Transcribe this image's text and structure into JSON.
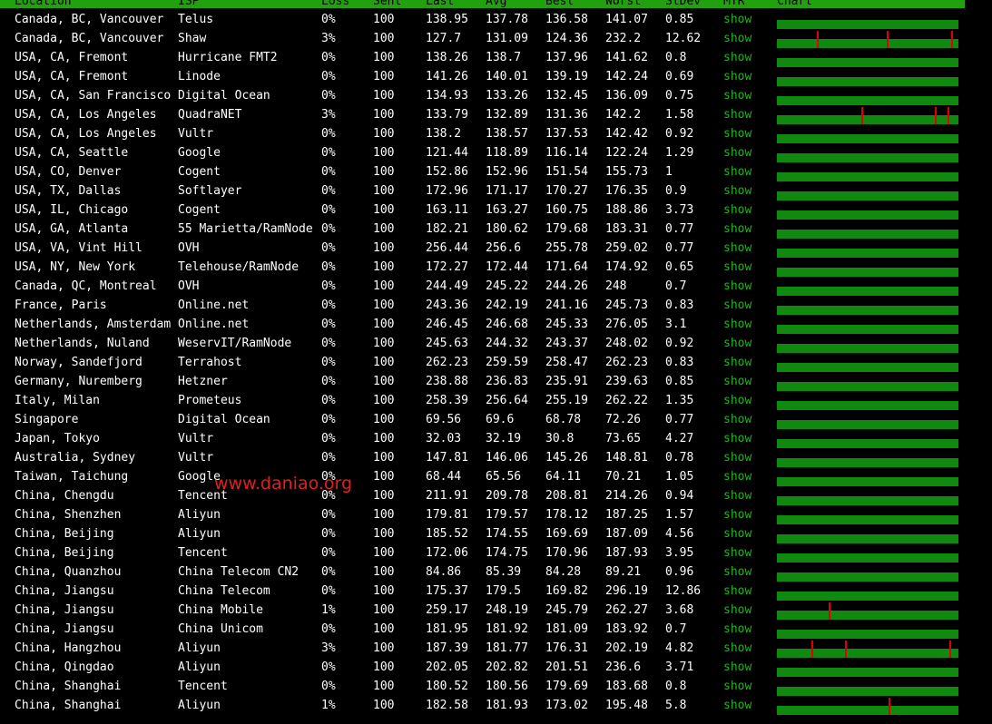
{
  "header": [
    "Location",
    "ISP",
    "Loss",
    "Sent",
    "Last",
    "Avg",
    "Best",
    "Worst",
    "StDev",
    "MTR",
    "Chart"
  ],
  "colors": {
    "bar": "#0f8a0f",
    "spike": "#e00000",
    "mtr": "#1fb51f",
    "header": "#22a10f",
    "watermark": "#e21e1e"
  },
  "watermark": "www.daniao.org",
  "rows": [
    {
      "location": "Canada, BC, Vancouver",
      "isp": "Telus",
      "loss": "0%",
      "sent": "100",
      "last": "138.95",
      "avg": "137.78",
      "best": "136.58",
      "worst": "141.07",
      "stdev": "0.85",
      "mtr": "show",
      "spikes": []
    },
    {
      "location": "Canada, BC, Vancouver",
      "isp": "Shaw",
      "loss": "3%",
      "sent": "100",
      "last": "127.7",
      "avg": "131.09",
      "best": "124.36",
      "worst": "232.2",
      "stdev": "12.62",
      "mtr": "show",
      "spikes": [
        0.22,
        0.61,
        0.97
      ]
    },
    {
      "location": "USA, CA, Fremont",
      "isp": "Hurricane FMT2",
      "loss": "0%",
      "sent": "100",
      "last": "138.26",
      "avg": "138.7",
      "best": "137.96",
      "worst": "141.62",
      "stdev": "0.8",
      "mtr": "show",
      "spikes": []
    },
    {
      "location": "USA, CA, Fremont",
      "isp": "Linode",
      "loss": "0%",
      "sent": "100",
      "last": "141.26",
      "avg": "140.01",
      "best": "139.19",
      "worst": "142.24",
      "stdev": "0.69",
      "mtr": "show",
      "spikes": []
    },
    {
      "location": "USA, CA, San Francisco",
      "isp": "Digital Ocean",
      "loss": "0%",
      "sent": "100",
      "last": "134.93",
      "avg": "133.26",
      "best": "132.45",
      "worst": "136.09",
      "stdev": "0.75",
      "mtr": "show",
      "spikes": []
    },
    {
      "location": "USA, CA, Los Angeles",
      "isp": "QuadraNET",
      "loss": "3%",
      "sent": "100",
      "last": "133.79",
      "avg": "132.89",
      "best": "131.36",
      "worst": "142.2",
      "stdev": "1.58",
      "mtr": "show",
      "spikes": [
        0.47,
        0.88,
        0.95
      ]
    },
    {
      "location": "USA, CA, Los Angeles",
      "isp": "Vultr",
      "loss": "0%",
      "sent": "100",
      "last": "138.2",
      "avg": "138.57",
      "best": "137.53",
      "worst": "142.42",
      "stdev": "0.92",
      "mtr": "show",
      "spikes": []
    },
    {
      "location": "USA, CA, Seattle",
      "isp": "Google",
      "loss": "0%",
      "sent": "100",
      "last": "121.44",
      "avg": "118.89",
      "best": "116.14",
      "worst": "122.24",
      "stdev": "1.29",
      "mtr": "show",
      "spikes": []
    },
    {
      "location": "USA, CO, Denver",
      "isp": "Cogent",
      "loss": "0%",
      "sent": "100",
      "last": "152.86",
      "avg": "152.96",
      "best": "151.54",
      "worst": "155.73",
      "stdev": "1",
      "mtr": "show",
      "spikes": []
    },
    {
      "location": "USA, TX, Dallas",
      "isp": "Softlayer",
      "loss": "0%",
      "sent": "100",
      "last": "172.96",
      "avg": "171.17",
      "best": "170.27",
      "worst": "176.35",
      "stdev": "0.9",
      "mtr": "show",
      "spikes": []
    },
    {
      "location": "USA, IL, Chicago",
      "isp": "Cogent",
      "loss": "0%",
      "sent": "100",
      "last": "163.11",
      "avg": "163.27",
      "best": "160.75",
      "worst": "188.86",
      "stdev": "3.73",
      "mtr": "show",
      "spikes": []
    },
    {
      "location": "USA, GA, Atlanta",
      "isp": "55 Marietta/RamNode",
      "loss": "0%",
      "sent": "100",
      "last": "182.21",
      "avg": "180.62",
      "best": "179.68",
      "worst": "183.31",
      "stdev": "0.77",
      "mtr": "show",
      "spikes": []
    },
    {
      "location": "USA, VA, Vint Hill",
      "isp": "OVH",
      "loss": "0%",
      "sent": "100",
      "last": "256.44",
      "avg": "256.6",
      "best": "255.78",
      "worst": "259.02",
      "stdev": "0.77",
      "mtr": "show",
      "spikes": []
    },
    {
      "location": "USA, NY, New York",
      "isp": "Telehouse/RamNode",
      "loss": "0%",
      "sent": "100",
      "last": "172.27",
      "avg": "172.44",
      "best": "171.64",
      "worst": "174.92",
      "stdev": "0.65",
      "mtr": "show",
      "spikes": []
    },
    {
      "location": "Canada, QC, Montreal",
      "isp": "OVH",
      "loss": "0%",
      "sent": "100",
      "last": "244.49",
      "avg": "245.22",
      "best": "244.26",
      "worst": "248",
      "stdev": "0.7",
      "mtr": "show",
      "spikes": []
    },
    {
      "location": "France, Paris",
      "isp": "Online.net",
      "loss": "0%",
      "sent": "100",
      "last": "243.36",
      "avg": "242.19",
      "best": "241.16",
      "worst": "245.73",
      "stdev": "0.83",
      "mtr": "show",
      "spikes": []
    },
    {
      "location": "Netherlands, Amsterdam",
      "isp": "Online.net",
      "loss": "0%",
      "sent": "100",
      "last": "246.45",
      "avg": "246.68",
      "best": "245.33",
      "worst": "276.05",
      "stdev": "3.1",
      "mtr": "show",
      "spikes": []
    },
    {
      "location": "Netherlands, Nuland",
      "isp": "WeservIT/RamNode",
      "loss": "0%",
      "sent": "100",
      "last": "245.63",
      "avg": "244.32",
      "best": "243.37",
      "worst": "248.02",
      "stdev": "0.92",
      "mtr": "show",
      "spikes": []
    },
    {
      "location": "Norway, Sandefjord",
      "isp": "Terrahost",
      "loss": "0%",
      "sent": "100",
      "last": "262.23",
      "avg": "259.59",
      "best": "258.47",
      "worst": "262.23",
      "stdev": "0.83",
      "mtr": "show",
      "spikes": []
    },
    {
      "location": "Germany, Nuremberg",
      "isp": "Hetzner",
      "loss": "0%",
      "sent": "100",
      "last": "238.88",
      "avg": "236.83",
      "best": "235.91",
      "worst": "239.63",
      "stdev": "0.85",
      "mtr": "show",
      "spikes": []
    },
    {
      "location": "Italy, Milan",
      "isp": "Prometeus",
      "loss": "0%",
      "sent": "100",
      "last": "258.39",
      "avg": "256.64",
      "best": "255.19",
      "worst": "262.22",
      "stdev": "1.35",
      "mtr": "show",
      "spikes": []
    },
    {
      "location": "Singapore",
      "isp": "Digital Ocean",
      "loss": "0%",
      "sent": "100",
      "last": "69.56",
      "avg": "69.6",
      "best": "68.78",
      "worst": "72.26",
      "stdev": "0.77",
      "mtr": "show",
      "spikes": []
    },
    {
      "location": "Japan, Tokyo",
      "isp": "Vultr",
      "loss": "0%",
      "sent": "100",
      "last": "32.03",
      "avg": "32.19",
      "best": "30.8",
      "worst": "73.65",
      "stdev": "4.27",
      "mtr": "show",
      "spikes": []
    },
    {
      "location": "Australia, Sydney",
      "isp": "Vultr",
      "loss": "0%",
      "sent": "100",
      "last": "147.81",
      "avg": "146.06",
      "best": "145.26",
      "worst": "148.81",
      "stdev": "0.78",
      "mtr": "show",
      "spikes": []
    },
    {
      "location": "Taiwan, Taichung",
      "isp": "Google",
      "loss": "0%",
      "sent": "100",
      "last": "68.44",
      "avg": "65.56",
      "best": "64.11",
      "worst": "70.21",
      "stdev": "1.05",
      "mtr": "show",
      "spikes": []
    },
    {
      "location": "China, Chengdu",
      "isp": "Tencent",
      "loss": "0%",
      "sent": "100",
      "last": "211.91",
      "avg": "209.78",
      "best": "208.81",
      "worst": "214.26",
      "stdev": "0.94",
      "mtr": "show",
      "spikes": []
    },
    {
      "location": "China, Shenzhen",
      "isp": "Aliyun",
      "loss": "0%",
      "sent": "100",
      "last": "179.81",
      "avg": "179.57",
      "best": "178.12",
      "worst": "187.25",
      "stdev": "1.57",
      "mtr": "show",
      "spikes": []
    },
    {
      "location": "China, Beijing",
      "isp": "Aliyun",
      "loss": "0%",
      "sent": "100",
      "last": "185.52",
      "avg": "174.55",
      "best": "169.69",
      "worst": "187.09",
      "stdev": "4.56",
      "mtr": "show",
      "spikes": []
    },
    {
      "location": "China, Beijing",
      "isp": "Tencent",
      "loss": "0%",
      "sent": "100",
      "last": "172.06",
      "avg": "174.75",
      "best": "170.96",
      "worst": "187.93",
      "stdev": "3.95",
      "mtr": "show",
      "spikes": []
    },
    {
      "location": "China, Quanzhou",
      "isp": "China Telecom CN2",
      "loss": "0%",
      "sent": "100",
      "last": "84.86",
      "avg": "85.39",
      "best": "84.28",
      "worst": "89.21",
      "stdev": "0.96",
      "mtr": "show",
      "spikes": []
    },
    {
      "location": "China, Jiangsu",
      "isp": "China Telecom",
      "loss": "0%",
      "sent": "100",
      "last": "175.37",
      "avg": "179.5",
      "best": "169.82",
      "worst": "296.19",
      "stdev": "12.86",
      "mtr": "show",
      "spikes": []
    },
    {
      "location": "China, Jiangsu",
      "isp": "China Mobile",
      "loss": "1%",
      "sent": "100",
      "last": "259.17",
      "avg": "248.19",
      "best": "245.79",
      "worst": "262.27",
      "stdev": "3.68",
      "mtr": "show",
      "spikes": [
        0.29
      ]
    },
    {
      "location": "China, Jiangsu",
      "isp": "China Unicom",
      "loss": "0%",
      "sent": "100",
      "last": "181.95",
      "avg": "181.92",
      "best": "181.09",
      "worst": "183.92",
      "stdev": "0.7",
      "mtr": "show",
      "spikes": []
    },
    {
      "location": "China, Hangzhou",
      "isp": "Aliyun",
      "loss": "3%",
      "sent": "100",
      "last": "187.39",
      "avg": "181.77",
      "best": "176.31",
      "worst": "202.19",
      "stdev": "4.82",
      "mtr": "show",
      "spikes": [
        0.19,
        0.38,
        0.96
      ]
    },
    {
      "location": "China, Qingdao",
      "isp": "Aliyun",
      "loss": "0%",
      "sent": "100",
      "last": "202.05",
      "avg": "202.82",
      "best": "201.51",
      "worst": "236.6",
      "stdev": "3.71",
      "mtr": "show",
      "spikes": []
    },
    {
      "location": "China, Shanghai",
      "isp": "Tencent",
      "loss": "0%",
      "sent": "100",
      "last": "180.52",
      "avg": "180.56",
      "best": "179.69",
      "worst": "183.68",
      "stdev": "0.8",
      "mtr": "show",
      "spikes": []
    },
    {
      "location": "China, Shanghai",
      "isp": "Aliyun",
      "loss": "1%",
      "sent": "100",
      "last": "182.58",
      "avg": "181.93",
      "best": "173.02",
      "worst": "195.48",
      "stdev": "5.8",
      "mtr": "show",
      "spikes": [
        0.62
      ]
    }
  ]
}
